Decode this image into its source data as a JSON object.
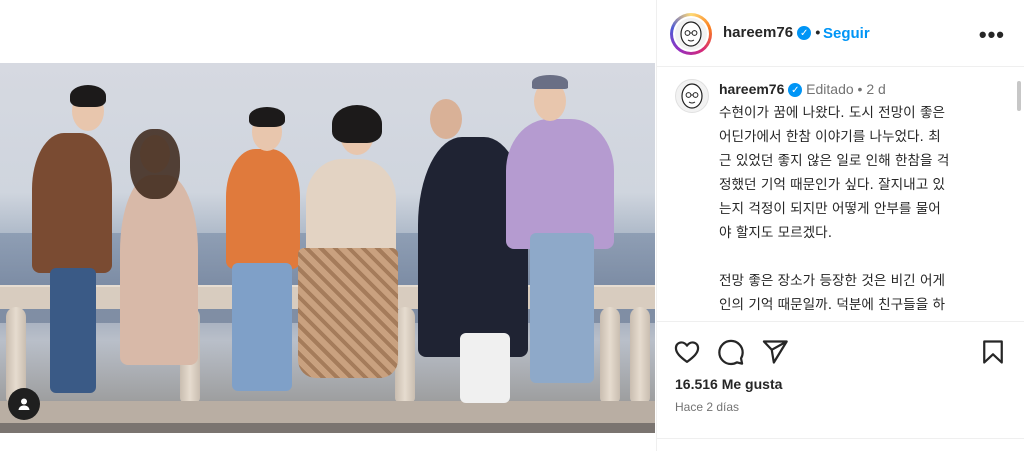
{
  "post": {
    "username": "hareem76",
    "follow_label": "Seguir",
    "more_label": "•••",
    "comment_username": "hareem76",
    "edited_label": "Editado",
    "age": "2 d",
    "caption": "수현이가 꿈에 나왔다. 도시 전망이 좋은\n어딘가에서 한참 이야기를 나누었다. 최\n근 있었던 좋지 않은 일로 인해 한참을 걱\n정했던 기억 때문인가 싶다. 잘지내고 있\n는지 걱정이 되지만 어떻게 안부를 물어\n야 할지도 모르겠다.\n\n전망 좋은 장소가 등장한 것은 비긴 어게\n인의 기억 때문일까. 덕분에 친구들을 하\n나하나 떠올렸다. 그 후 시간이 많이 흘렀\n다. 멤버 중 누군가는 음악을 멈추고 외국\n으로 떠났고, 누군가는 유명인이 되고, 한",
    "likes": "16.516 Me gusta",
    "timestamp": "Hace 2 días"
  },
  "icons": {
    "like": "heart-icon",
    "comment": "comment-icon",
    "share": "share-icon",
    "save": "bookmark-icon",
    "tagged": "person-icon"
  },
  "colors": {
    "accent": "#0095f6",
    "text": "#262626",
    "muted": "#737373",
    "border": "#efefef"
  }
}
